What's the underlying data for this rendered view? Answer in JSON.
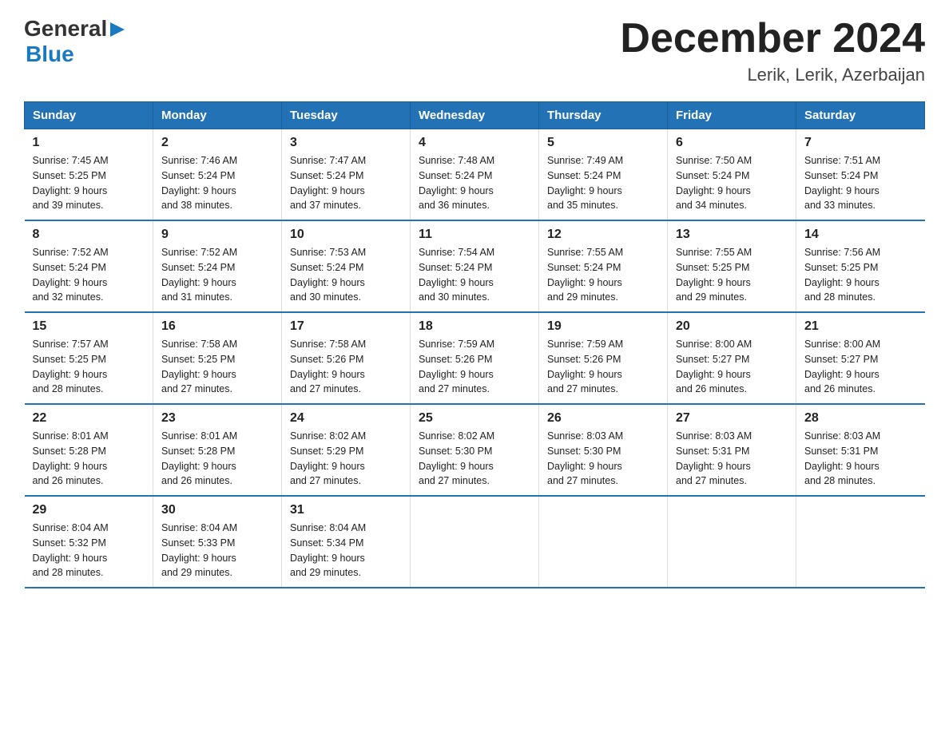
{
  "header": {
    "logo_general": "General",
    "logo_blue": "Blue",
    "month_title": "December 2024",
    "location": "Lerik, Lerik, Azerbaijan"
  },
  "days_of_week": [
    "Sunday",
    "Monday",
    "Tuesday",
    "Wednesday",
    "Thursday",
    "Friday",
    "Saturday"
  ],
  "weeks": [
    [
      {
        "day": "1",
        "sunrise": "7:45 AM",
        "sunset": "5:25 PM",
        "daylight": "9 hours and 39 minutes."
      },
      {
        "day": "2",
        "sunrise": "7:46 AM",
        "sunset": "5:24 PM",
        "daylight": "9 hours and 38 minutes."
      },
      {
        "day": "3",
        "sunrise": "7:47 AM",
        "sunset": "5:24 PM",
        "daylight": "9 hours and 37 minutes."
      },
      {
        "day": "4",
        "sunrise": "7:48 AM",
        "sunset": "5:24 PM",
        "daylight": "9 hours and 36 minutes."
      },
      {
        "day": "5",
        "sunrise": "7:49 AM",
        "sunset": "5:24 PM",
        "daylight": "9 hours and 35 minutes."
      },
      {
        "day": "6",
        "sunrise": "7:50 AM",
        "sunset": "5:24 PM",
        "daylight": "9 hours and 34 minutes."
      },
      {
        "day": "7",
        "sunrise": "7:51 AM",
        "sunset": "5:24 PM",
        "daylight": "9 hours and 33 minutes."
      }
    ],
    [
      {
        "day": "8",
        "sunrise": "7:52 AM",
        "sunset": "5:24 PM",
        "daylight": "9 hours and 32 minutes."
      },
      {
        "day": "9",
        "sunrise": "7:52 AM",
        "sunset": "5:24 PM",
        "daylight": "9 hours and 31 minutes."
      },
      {
        "day": "10",
        "sunrise": "7:53 AM",
        "sunset": "5:24 PM",
        "daylight": "9 hours and 30 minutes."
      },
      {
        "day": "11",
        "sunrise": "7:54 AM",
        "sunset": "5:24 PM",
        "daylight": "9 hours and 30 minutes."
      },
      {
        "day": "12",
        "sunrise": "7:55 AM",
        "sunset": "5:24 PM",
        "daylight": "9 hours and 29 minutes."
      },
      {
        "day": "13",
        "sunrise": "7:55 AM",
        "sunset": "5:25 PM",
        "daylight": "9 hours and 29 minutes."
      },
      {
        "day": "14",
        "sunrise": "7:56 AM",
        "sunset": "5:25 PM",
        "daylight": "9 hours and 28 minutes."
      }
    ],
    [
      {
        "day": "15",
        "sunrise": "7:57 AM",
        "sunset": "5:25 PM",
        "daylight": "9 hours and 28 minutes."
      },
      {
        "day": "16",
        "sunrise": "7:58 AM",
        "sunset": "5:25 PM",
        "daylight": "9 hours and 27 minutes."
      },
      {
        "day": "17",
        "sunrise": "7:58 AM",
        "sunset": "5:26 PM",
        "daylight": "9 hours and 27 minutes."
      },
      {
        "day": "18",
        "sunrise": "7:59 AM",
        "sunset": "5:26 PM",
        "daylight": "9 hours and 27 minutes."
      },
      {
        "day": "19",
        "sunrise": "7:59 AM",
        "sunset": "5:26 PM",
        "daylight": "9 hours and 27 minutes."
      },
      {
        "day": "20",
        "sunrise": "8:00 AM",
        "sunset": "5:27 PM",
        "daylight": "9 hours and 26 minutes."
      },
      {
        "day": "21",
        "sunrise": "8:00 AM",
        "sunset": "5:27 PM",
        "daylight": "9 hours and 26 minutes."
      }
    ],
    [
      {
        "day": "22",
        "sunrise": "8:01 AM",
        "sunset": "5:28 PM",
        "daylight": "9 hours and 26 minutes."
      },
      {
        "day": "23",
        "sunrise": "8:01 AM",
        "sunset": "5:28 PM",
        "daylight": "9 hours and 26 minutes."
      },
      {
        "day": "24",
        "sunrise": "8:02 AM",
        "sunset": "5:29 PM",
        "daylight": "9 hours and 27 minutes."
      },
      {
        "day": "25",
        "sunrise": "8:02 AM",
        "sunset": "5:30 PM",
        "daylight": "9 hours and 27 minutes."
      },
      {
        "day": "26",
        "sunrise": "8:03 AM",
        "sunset": "5:30 PM",
        "daylight": "9 hours and 27 minutes."
      },
      {
        "day": "27",
        "sunrise": "8:03 AM",
        "sunset": "5:31 PM",
        "daylight": "9 hours and 27 minutes."
      },
      {
        "day": "28",
        "sunrise": "8:03 AM",
        "sunset": "5:31 PM",
        "daylight": "9 hours and 28 minutes."
      }
    ],
    [
      {
        "day": "29",
        "sunrise": "8:04 AM",
        "sunset": "5:32 PM",
        "daylight": "9 hours and 28 minutes."
      },
      {
        "day": "30",
        "sunrise": "8:04 AM",
        "sunset": "5:33 PM",
        "daylight": "9 hours and 29 minutes."
      },
      {
        "day": "31",
        "sunrise": "8:04 AM",
        "sunset": "5:34 PM",
        "daylight": "9 hours and 29 minutes."
      },
      null,
      null,
      null,
      null
    ]
  ],
  "labels": {
    "sunrise": "Sunrise:",
    "sunset": "Sunset:",
    "daylight": "Daylight:"
  }
}
